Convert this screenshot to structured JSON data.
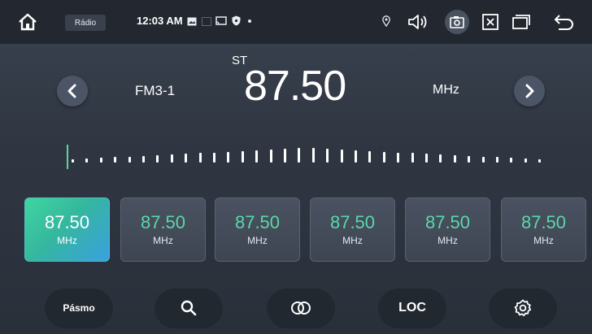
{
  "status_bar": {
    "app_label": "Rádio",
    "time": "12:03 AM"
  },
  "tuner": {
    "stereo_indicator": "ST",
    "band": "FM3-1",
    "frequency": "87.50",
    "unit": "MHz"
  },
  "presets": [
    {
      "frequency": "87.50",
      "unit": "MHz",
      "active": true
    },
    {
      "frequency": "87.50",
      "unit": "MHz",
      "active": false
    },
    {
      "frequency": "87.50",
      "unit": "MHz",
      "active": false
    },
    {
      "frequency": "87.50",
      "unit": "MHz",
      "active": false
    },
    {
      "frequency": "87.50",
      "unit": "MHz",
      "active": false
    },
    {
      "frequency": "87.50",
      "unit": "MHz",
      "active": false
    }
  ],
  "bottom_bar": {
    "mute_label": "Pásmo",
    "loc_label": "LOC"
  },
  "colors": {
    "accent_green": "#5ad8a8",
    "active_gradient_start": "#3fd6a1",
    "active_gradient_end": "#3aa0e0",
    "background": "#2f3642"
  },
  "icons": [
    "home-icon",
    "image-icon",
    "cast-icon",
    "shield-icon",
    "location-pin-icon",
    "volume-icon",
    "screenshot-icon",
    "close-box-icon",
    "recent-apps-icon",
    "back-icon",
    "chevron-left-icon",
    "chevron-right-icon",
    "search-icon",
    "stereo-icon",
    "gear-icon"
  ]
}
